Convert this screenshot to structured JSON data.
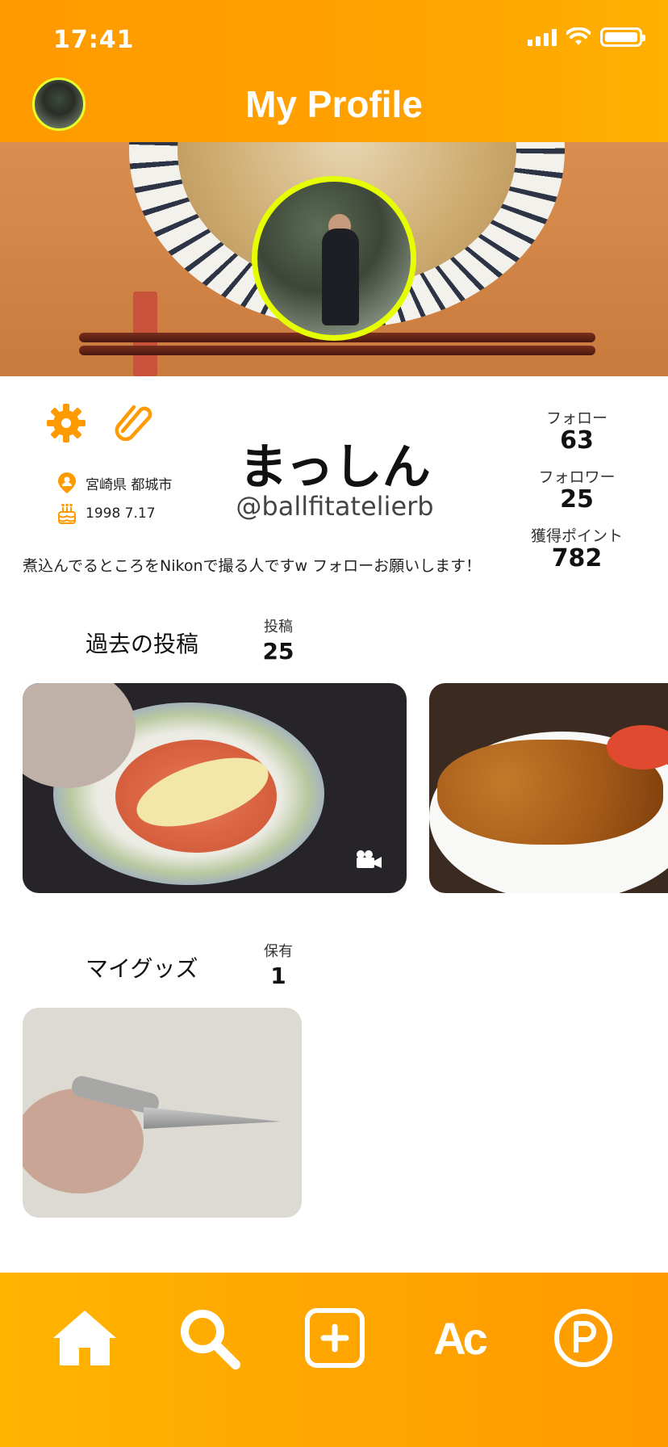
{
  "status_bar": {
    "time": "17:41"
  },
  "header": {
    "title": "My Profile"
  },
  "profile": {
    "display_name": "まっしん",
    "handle": "@ballfitatelierb",
    "location": "宮崎県 都城市",
    "birthday": "1998 7.17",
    "bio": "煮込んでるところをNikonで撮る人ですw フォローお願いします！",
    "stats": [
      {
        "label": "フォロー",
        "value": "63"
      },
      {
        "label": "フォロワー",
        "value": "25"
      },
      {
        "label": "獲得ポイント",
        "value": "782"
      }
    ]
  },
  "posts_section": {
    "title": "過去の投稿",
    "count_label": "投稿",
    "count": "25"
  },
  "goods_section": {
    "title": "マイグッズ",
    "count_label": "保有",
    "count": "1"
  },
  "bottom_nav": {
    "items": [
      "home-icon",
      "search-icon",
      "add-post-icon",
      "Ac",
      "points-icon"
    ],
    "ac_label": "Ac"
  },
  "colors": {
    "accent": "#ff9f00",
    "avatar_ring": "#e6ff00",
    "icon_orange": "#ff9a00"
  }
}
